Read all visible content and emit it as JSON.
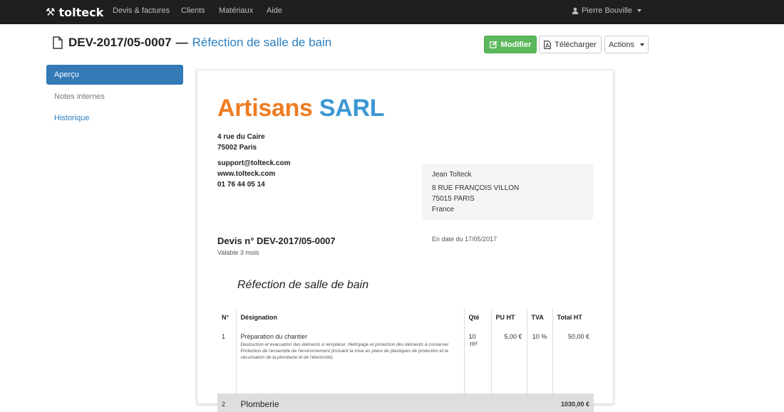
{
  "navbar": {
    "brand": "tolteck",
    "links": [
      "Devis & factures",
      "Clients",
      "Matériaux",
      "Aide"
    ],
    "user": "Pierre Bouville"
  },
  "header": {
    "ref": "DEV-2017/05-0007",
    "separator": "—",
    "name": "Réfection de salle de bain",
    "buttons": {
      "modifier": "Modifier",
      "telecharger": "Télécharger",
      "actions": "Actions"
    }
  },
  "sidebar": {
    "items": [
      "Aperçu",
      "Notes internes",
      "Historique"
    ]
  },
  "document": {
    "company_part1": "Artisans",
    "company_part2": "SARL",
    "address_lines": [
      "4 rue du Caire",
      "75002 Paris"
    ],
    "contact_lines": [
      "support@tolteck.com",
      "www.tolteck.com",
      "01 76 44 05 14"
    ],
    "client": {
      "name": "Jean Tolteck",
      "street": "8 RUE FRANÇOIS VILLON",
      "city": "75015 PARIS",
      "country": "France"
    },
    "devis_title": "Devis n° DEV-2017/05-0007",
    "validity": "Valable 3 mois",
    "date": "En date du 17/05/2017",
    "section_title": "Réfection de salle de bain",
    "table": {
      "headers": [
        "N°",
        "Désignation",
        "Qté",
        "PU HT",
        "TVA",
        "Total HT"
      ],
      "rows": [
        {
          "num": "1",
          "designation": "Préparation du chantier",
          "description": "Destruction et évacuation des éléments à remplacer. Nettoyage et protection des éléments à conserver. Protection de l'ensemble de l'environnement (incluant la mise en place de plastiques de protection et la sécurisation de la plomberie et de l'électricité).",
          "qty": "10",
          "unit": "m²",
          "pu": "5,00 €",
          "tva": "10 %",
          "total": "50,00 €"
        },
        {
          "num": "2",
          "designation": "Plomberie",
          "total": "1030,00 €"
        }
      ]
    }
  },
  "colors": {
    "navbar": "#1f1f1f",
    "accent_blue": "#337ab7",
    "link_blue": "#2a7fc1",
    "success_green": "#5cb85c",
    "brand_orange": "#ef7d22",
    "brand_blue": "#3c97d3"
  },
  "icons": {
    "brand": "tools-icon",
    "user": "user-icon",
    "title": "file-icon",
    "modifier": "edit-icon",
    "telecharger": "pdf-icon"
  }
}
